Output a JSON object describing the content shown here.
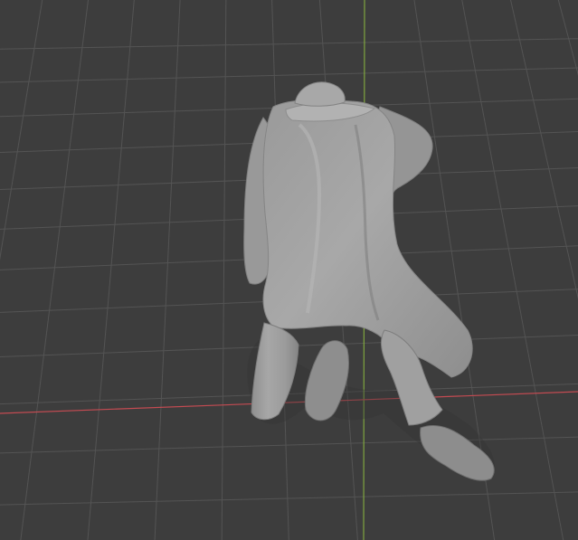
{
  "viewport": {
    "background_color": "#3d3d3d",
    "grid_color": "#545454",
    "x_axis_color": "#c44b52",
    "y_axis_color": "#7fa53f",
    "model_color": "#9f9f9f",
    "model_highlight_color": "#bdbdbd",
    "model_shadow_color": "#6f6f6f"
  }
}
